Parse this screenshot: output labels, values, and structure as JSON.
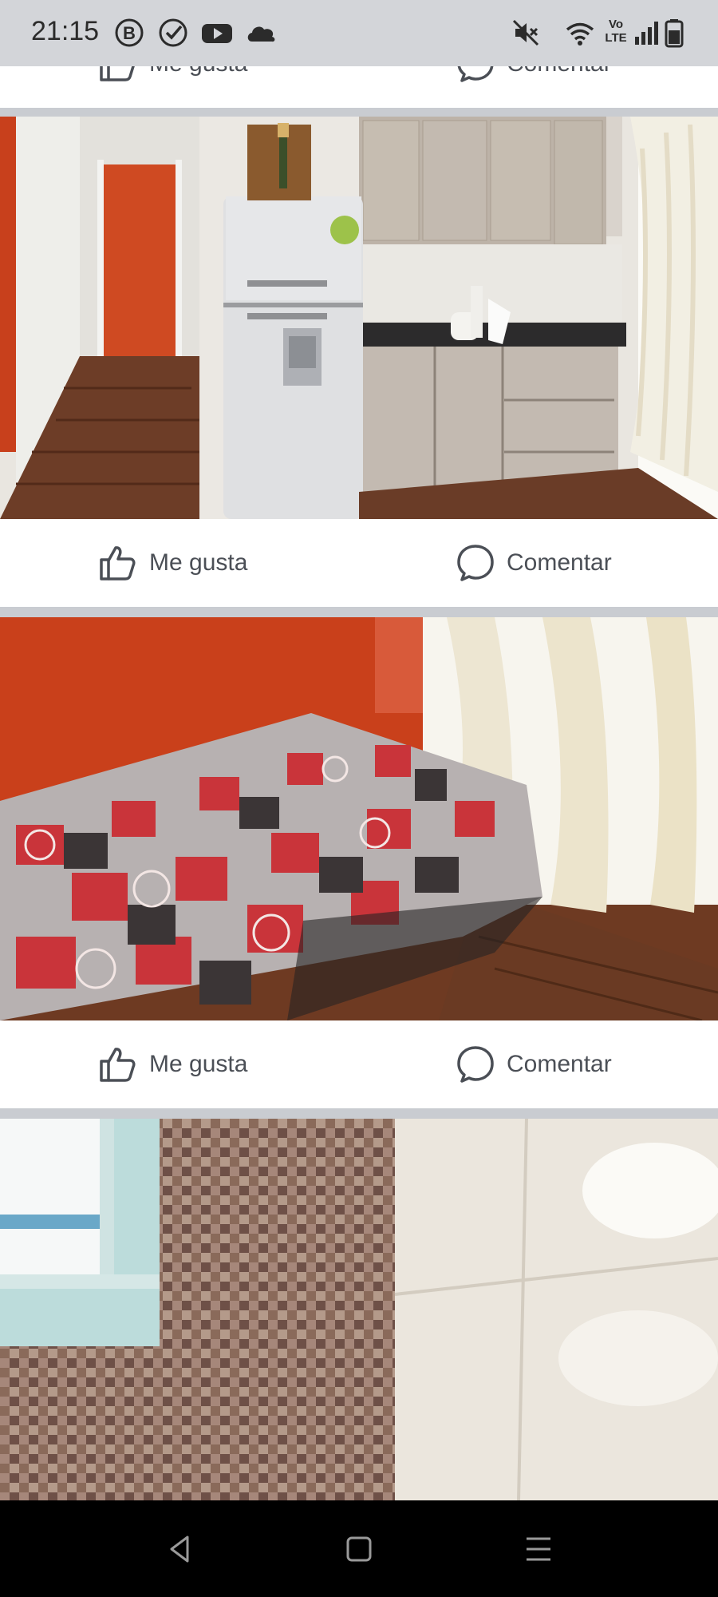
{
  "status_bar": {
    "time": "21:15",
    "left_icons": [
      "b-badge-icon",
      "check-circle-icon",
      "youtube-icon",
      "cloud-icon"
    ],
    "right_icons": [
      "mute-icon",
      "wifi-icon",
      "volte-icon",
      "signal-icon",
      "battery-icon"
    ],
    "volte_label_top": "Vo",
    "volte_label_bottom": "LTE"
  },
  "posts": [
    {
      "like_label": "Me gusta",
      "comment_label": "Comentar",
      "photo": "kitchen-photo"
    },
    {
      "like_label": "Me gusta",
      "comment_label": "Comentar",
      "photo": "bedroom-photo"
    },
    {
      "like_label": "Me gusta",
      "comment_label": "Comentar",
      "photo": "bathroom-photo"
    }
  ],
  "top_partial": {
    "like_label": "Me gusta",
    "comment_label": "Comentar"
  },
  "nav_bar": {
    "buttons": [
      "back-icon",
      "home-icon",
      "menu-icon"
    ]
  },
  "colors": {
    "accent_wall": "#d2441c",
    "action_text": "#4b4f56",
    "divider": "#c9ccd1"
  }
}
